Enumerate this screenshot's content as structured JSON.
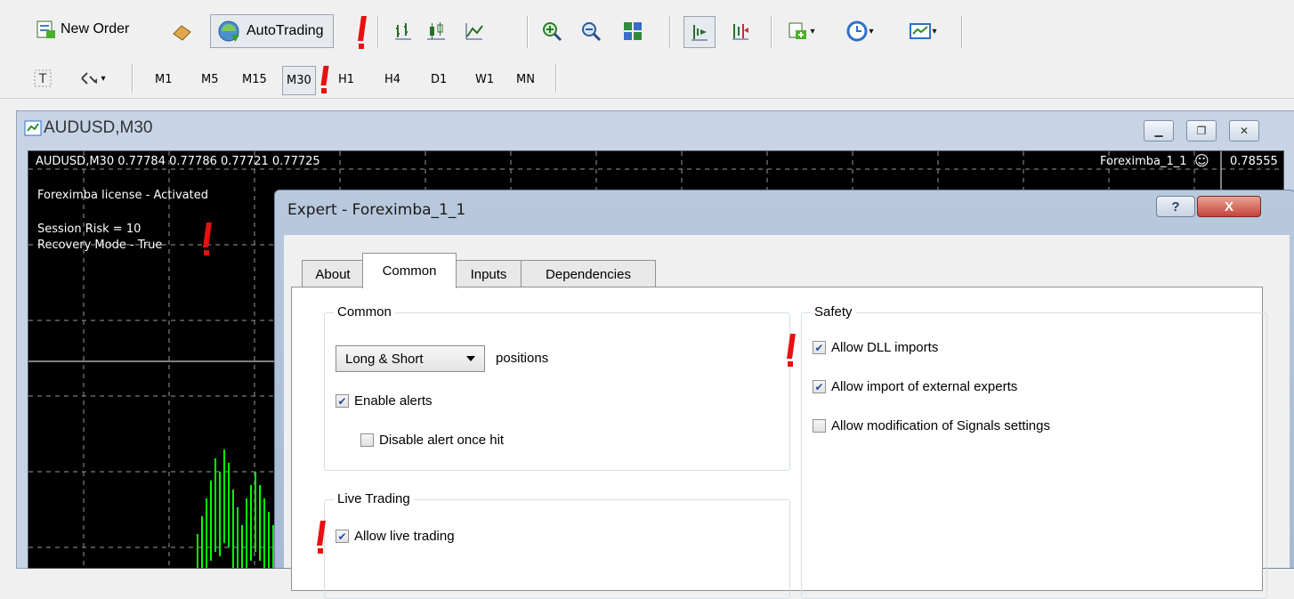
{
  "toolbar": {
    "new_order_label": "New Order",
    "autotrading_label": "AutoTrading"
  },
  "timeframes": [
    "M1",
    "M5",
    "M15",
    "M30",
    "H1",
    "H4",
    "D1",
    "W1",
    "MN"
  ],
  "window": {
    "title": "AUDUSD,M30"
  },
  "chart": {
    "header": "AUDUSD,M30  0.77784 0.77786 0.77721 0.77725",
    "ea_label": "Foreximba_1_1",
    "ea_smiley": "☺",
    "price_label": "0.78555",
    "license_text": "Foreximba license - Activated",
    "session_risk": "Session Risk = 10",
    "recovery_mode": "Recovery Mode - True"
  },
  "dialog": {
    "title": "Expert - Foreximba_1_1",
    "help_label": "?",
    "close_label": "X",
    "tabs": [
      "About",
      "Common",
      "Inputs",
      "Dependencies"
    ],
    "active_tab": "Common",
    "common_group": {
      "label": "Common",
      "positions_select": "Long & Short",
      "positions_suffix": "positions",
      "enable_alerts": "Enable alerts",
      "disable_alert_once_hit": "Disable alert once hit"
    },
    "live_trading_group": {
      "label": "Live Trading",
      "allow_live_trading": "Allow live trading"
    },
    "safety_group": {
      "label": "Safety",
      "allow_dll_imports": "Allow DLL imports",
      "allow_import_external": "Allow import of external experts",
      "allow_modification_signals": "Allow modification of Signals settings"
    }
  },
  "checked": {
    "enable_alerts": true,
    "disable_alert_once_hit": false,
    "allow_live_trading": true,
    "allow_dll_imports": true,
    "allow_import_external": true,
    "allow_modification_signals": false
  },
  "colors": {
    "annotation_marker": "#e81010",
    "chart_background": "#000000",
    "candle_green": "#00ff00"
  }
}
